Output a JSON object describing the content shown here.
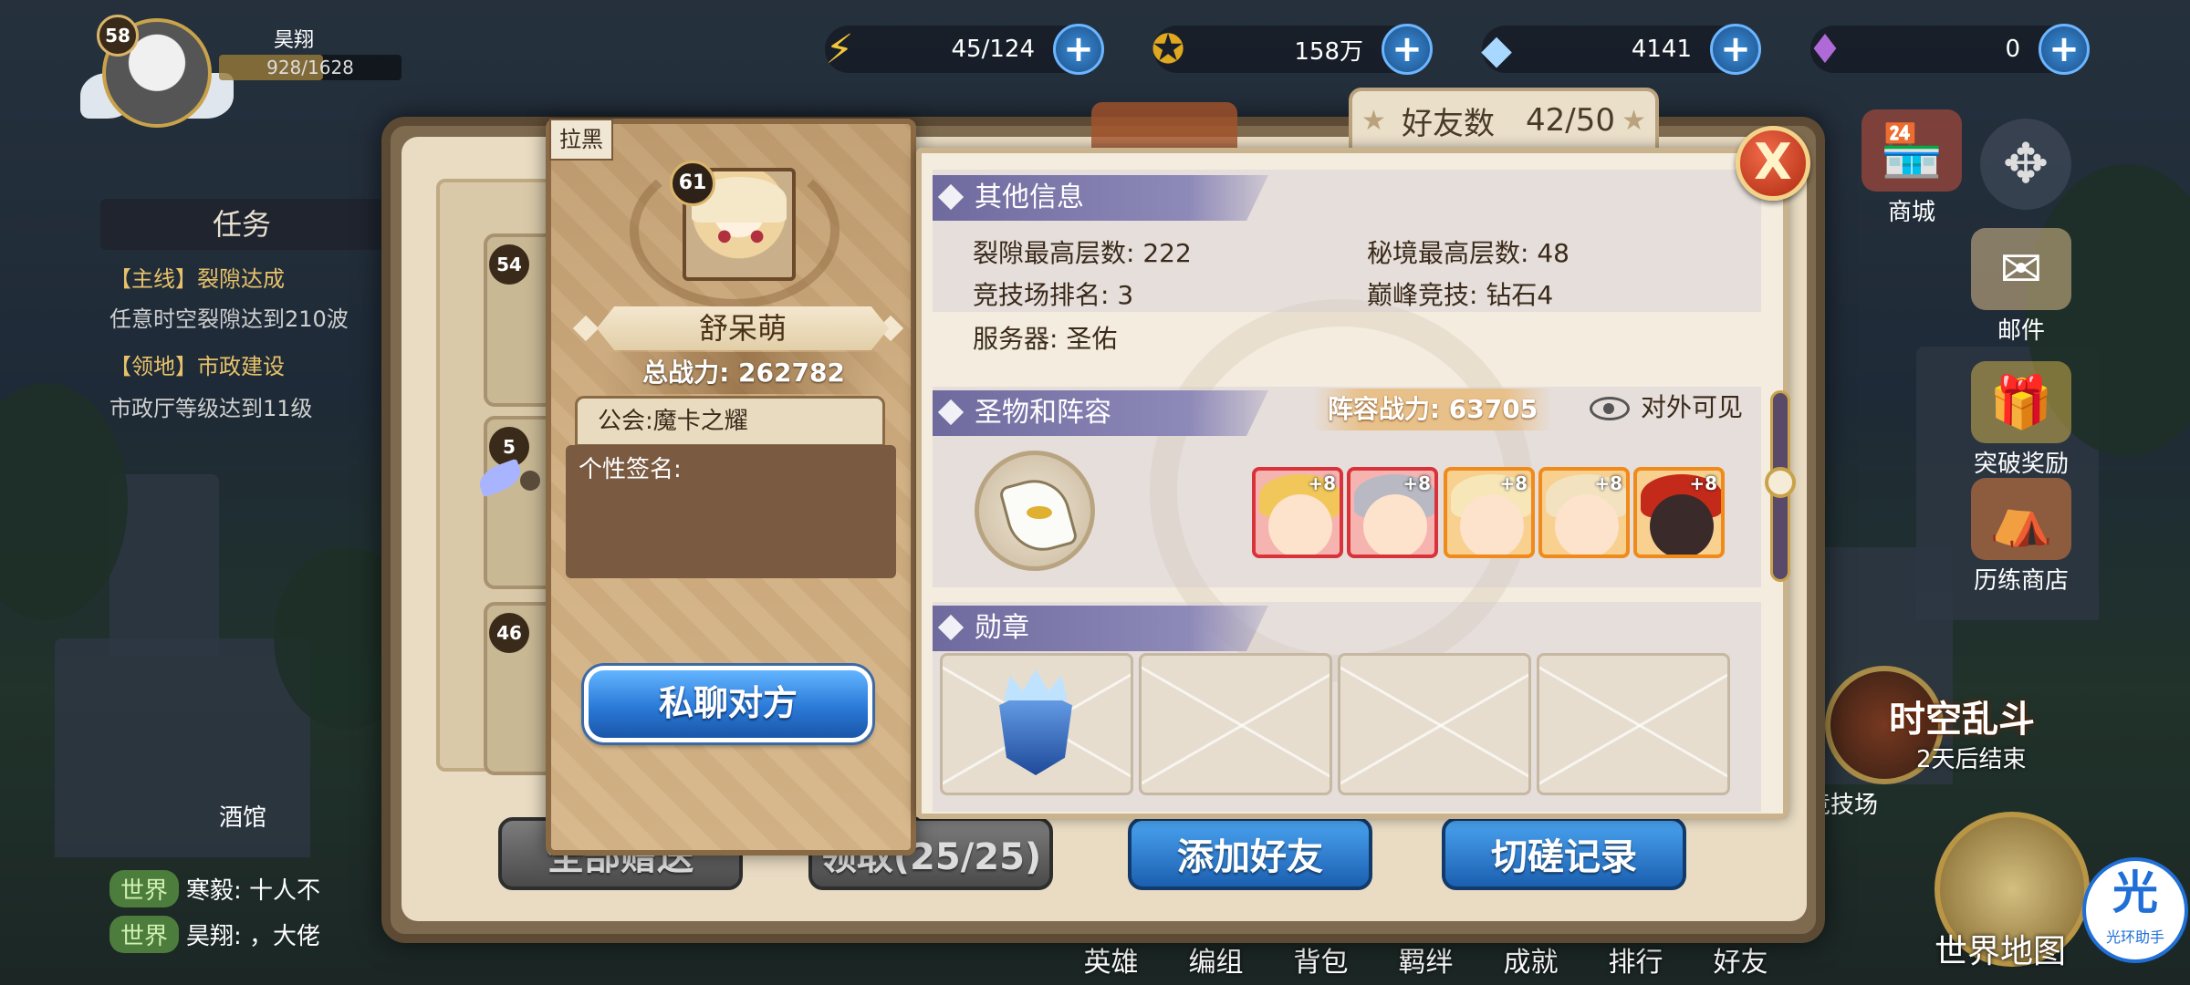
{
  "hud": {
    "level": "58",
    "player_name": "昊翔",
    "exp": "928/1628",
    "exp_fraction": 0.57,
    "stamina": "45/124",
    "gold": "158万",
    "diamonds": "4141",
    "crystals": "0",
    "plus": "+"
  },
  "tasks": {
    "title": "任务",
    "main_tag": "【主线】",
    "main_name": "裂隙达成",
    "main_desc": "任意时空裂隙达到210波",
    "territory_tag": "【领地】",
    "territory_name": "市政建设",
    "territory_desc": "市政厅等级达到11级"
  },
  "chat": [
    {
      "channel": "世界",
      "text": "寒毅: 十人不"
    },
    {
      "channel": "世界",
      "text": "昊翔: ，大佬"
    }
  ],
  "tavern": "酒馆",
  "side_icons": {
    "shop": "商城",
    "mail": "邮件",
    "breakthrough": "突破奖励",
    "training_shop": "历练商店"
  },
  "event": {
    "title": "时空乱斗",
    "subtitle": "2天后结束",
    "arena": "竞技场"
  },
  "world_map": "世界地图",
  "helper": {
    "icon": "光",
    "label": "光环助手"
  },
  "bottom_nav": [
    "英雄",
    "编组",
    "背包",
    "羁绊",
    "成就",
    "排行",
    "好友"
  ],
  "friends_window": {
    "title": "好友",
    "count_label": "好友数",
    "count_value": "42/50",
    "list_levels": [
      "54",
      "5",
      "46"
    ],
    "btn_give_all": "全部赠送",
    "btn_receive": "领取(25/25)",
    "btn_add_friend": "添加好友",
    "btn_spar_log": "切磋记录"
  },
  "profile": {
    "blacklist": "拉黑",
    "level": "61",
    "name": "舒呆萌",
    "power_label": "总战力:",
    "power_value": "262782",
    "guild": "公会:魔卡之耀",
    "signature_label": "个性签名:",
    "dm_button": "私聊对方"
  },
  "details": {
    "other_info_title": "其他信息",
    "rift_max": "裂隙最高层数: 222",
    "secret_max": "秘境最高层数: 48",
    "arena_rank": "竞技场排名: 3",
    "peak_arena": "巅峰竞技: 钻石4",
    "server": "服务器: 圣佑",
    "relic_title": "圣物和阵容",
    "lineup_power": "阵容战力: 63705",
    "visibility": "对外可见",
    "heroes": [
      {
        "plus": "+8",
        "color": "#d8323a",
        "hair": "#f2c75a"
      },
      {
        "plus": "+8",
        "color": "#d8323a",
        "hair": "#b9b9c4"
      },
      {
        "plus": "+8",
        "color": "#f08a1a",
        "hair": "#f6e6b8"
      },
      {
        "plus": "+8",
        "color": "#f08a1a",
        "hair": "#f3e2c0"
      },
      {
        "plus": "+8",
        "color": "#f08a1a",
        "hair": "#c42a1a"
      }
    ],
    "medal_title": "勋章",
    "close": "X"
  }
}
